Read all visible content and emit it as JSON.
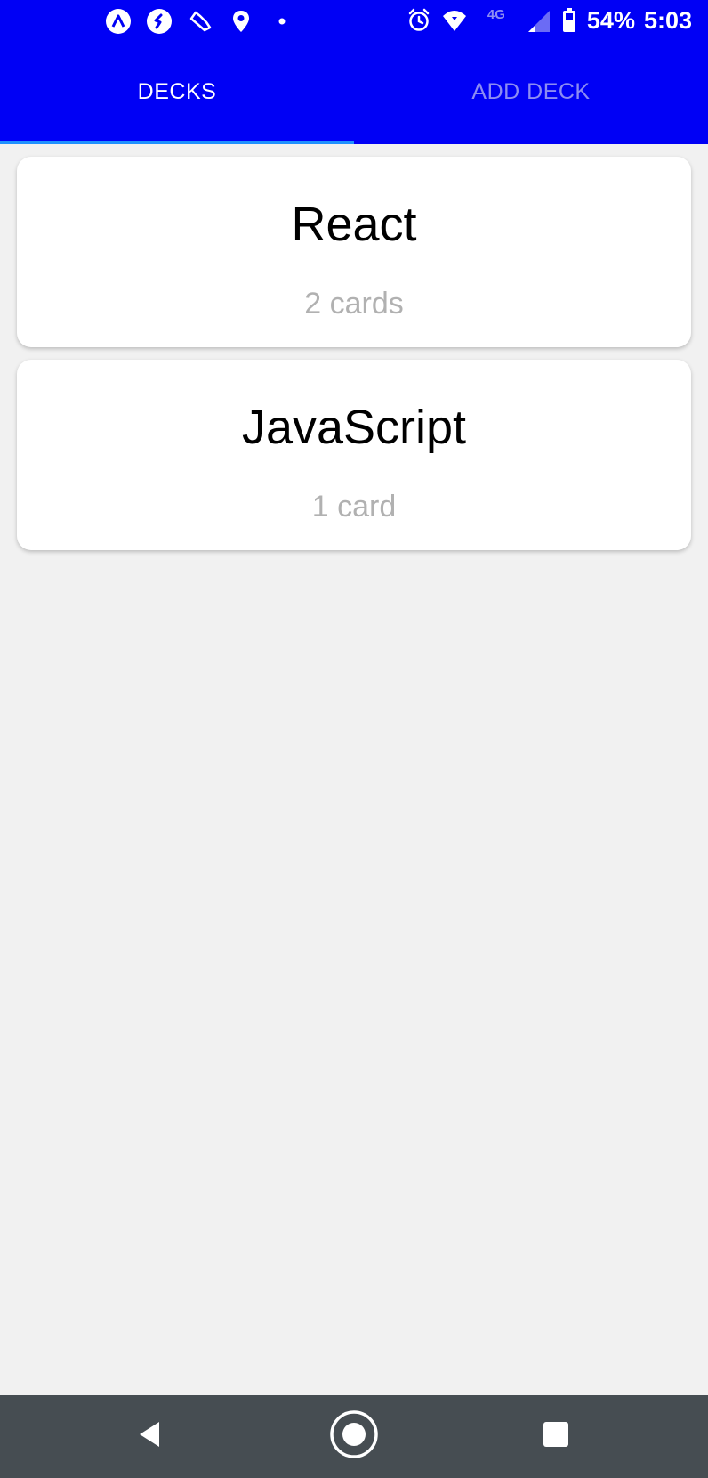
{
  "status_bar": {
    "left_icons": [
      "expo-icon",
      "shazam-icon",
      "fitness-icon",
      "location-icon",
      "notification-dot-icon"
    ],
    "right_icons": [
      "alarm-icon",
      "wifi-icon",
      "lte-icon",
      "signal-icon",
      "battery-icon"
    ],
    "battery_percent": "54%",
    "time": "5:03",
    "network_label": "4G"
  },
  "tabs": [
    {
      "label": "DECKS",
      "active": true
    },
    {
      "label": "ADD DECK",
      "active": false
    }
  ],
  "decks": [
    {
      "title": "React",
      "count": "2 cards"
    },
    {
      "title": "JavaScript",
      "count": "1 card"
    }
  ],
  "nav_bar": {
    "buttons": [
      "back-icon",
      "home-icon",
      "recents-icon"
    ]
  },
  "colors": {
    "primary": "#0000f5",
    "tab_indicator": "#1e90ff",
    "inactive_tab": "#8c8cf2",
    "background": "#f1f1f1",
    "nav_bar": "#464d52",
    "count_text": "#b1b1b1"
  }
}
